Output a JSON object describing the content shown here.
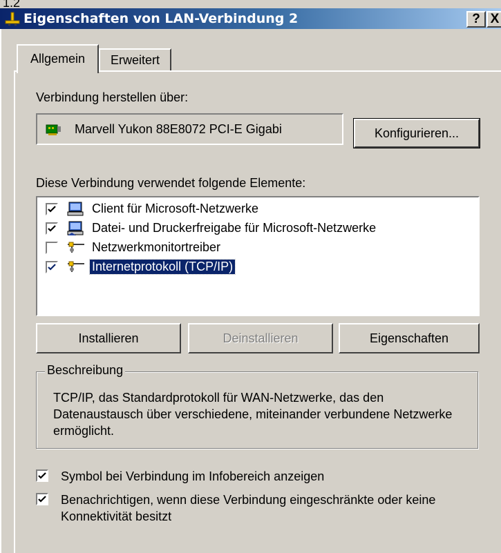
{
  "outside_label": "1.2",
  "titlebar": {
    "title": "Eigenschaften von LAN-Verbindung 2",
    "help_label": "?",
    "close_label": "X"
  },
  "tabs": [
    {
      "label": "Allgemein",
      "active": true
    },
    {
      "label": "Erweitert",
      "active": false
    }
  ],
  "connect_via": {
    "label": "Verbindung herstellen über:",
    "adapter": "Marvell Yukon 88E8072 PCI-E Gigabi",
    "configure_label": "Konfigurieren..."
  },
  "elements": {
    "label": "Diese Verbindung verwendet folgende Elemente:",
    "items": [
      {
        "label": "Client für Microsoft-Netzwerke",
        "checked": true,
        "icon": "network-client-icon",
        "selected": false
      },
      {
        "label": "Datei- und Druckerfreigabe für Microsoft-Netzwerke",
        "checked": true,
        "icon": "file-printer-sharing-icon",
        "selected": false
      },
      {
        "label": "Netzwerkmonitortreiber",
        "checked": false,
        "icon": "protocol-icon",
        "selected": false
      },
      {
        "label": "Internetprotokoll (TCP/IP)",
        "checked": true,
        "icon": "protocol-icon",
        "selected": true
      }
    ]
  },
  "buttons": {
    "install": "Installieren",
    "uninstall": "Deinstallieren",
    "properties": "Eigenschaften"
  },
  "description": {
    "legend": "Beschreibung",
    "text": "TCP/IP, das Standardprotokoll für WAN-Netzwerke, das den Datenaustausch über verschiedene, miteinander verbundene Netzwerke ermöglicht."
  },
  "options": [
    {
      "label": "Symbol bei Verbindung im Infobereich anzeigen",
      "checked": true
    },
    {
      "label": "Benachrichtigen, wenn diese Verbindung eingeschränkte oder keine Konnektivität besitzt",
      "checked": true
    }
  ],
  "colors": {
    "title_start": "#0a246a",
    "title_end": "#a6caf0",
    "face": "#d4d0c8",
    "selection": "#0a246a"
  }
}
